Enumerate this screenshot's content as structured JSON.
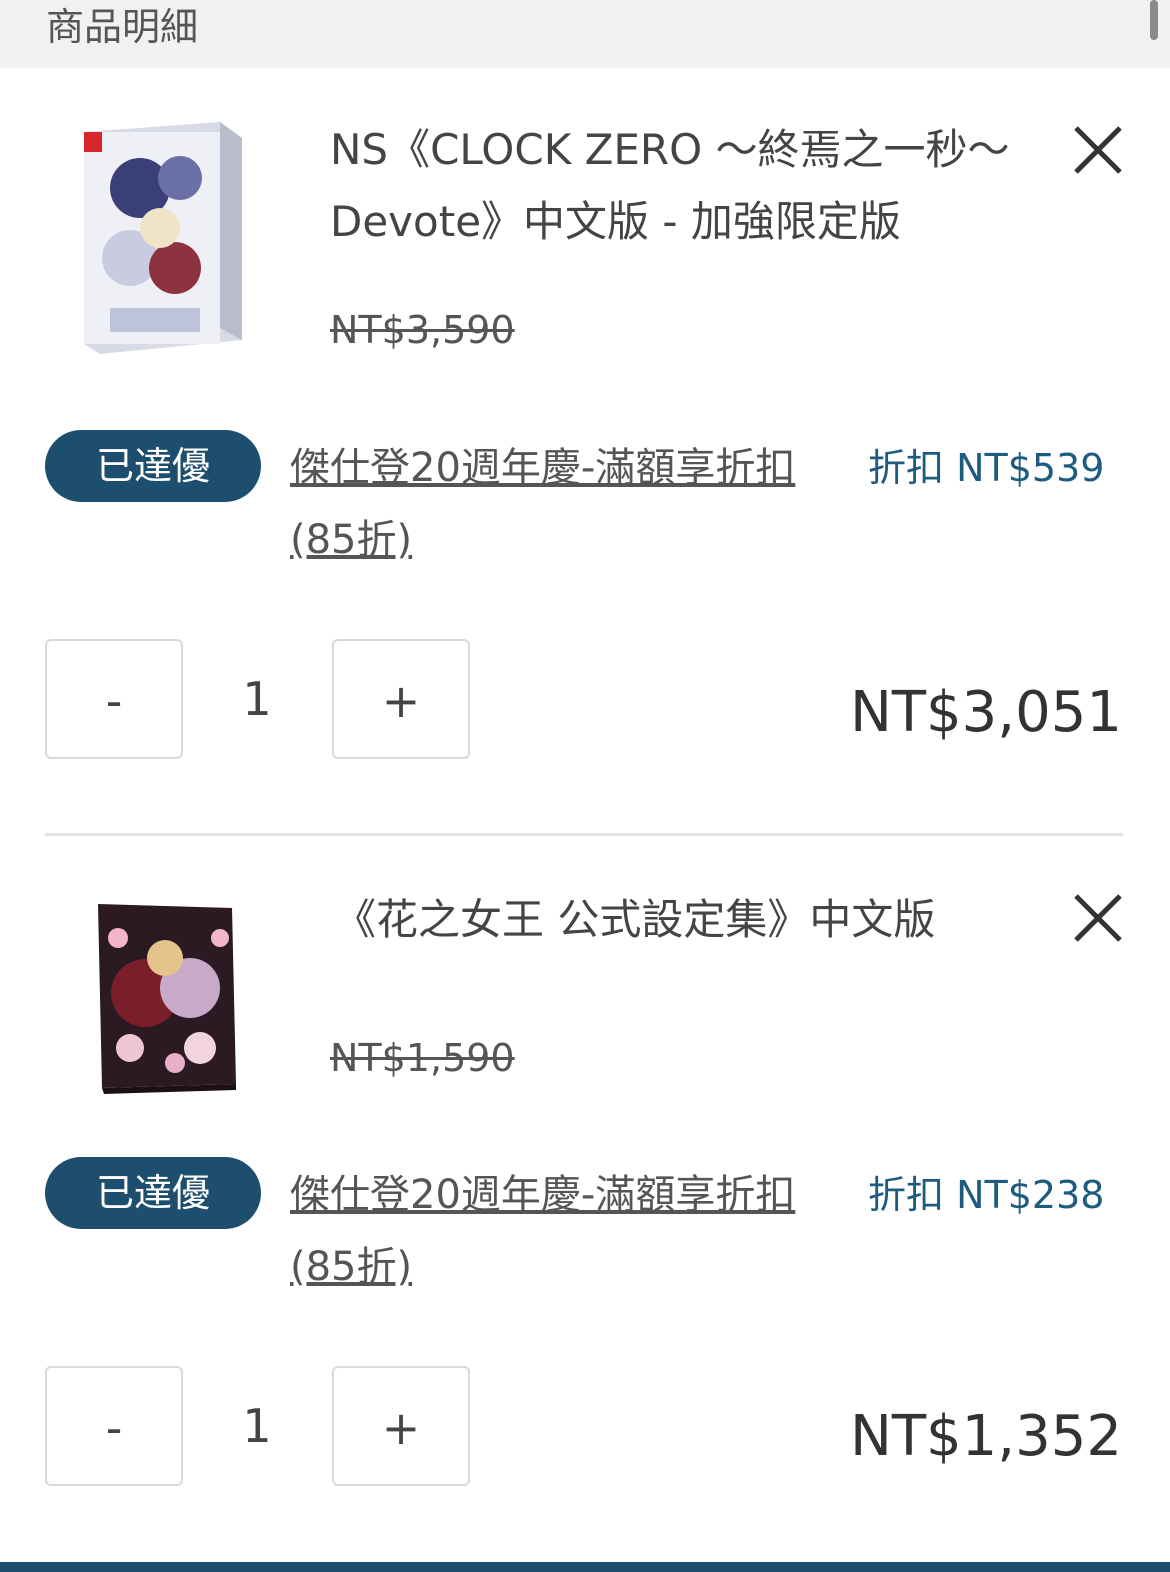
{
  "header": {
    "title": "商品明細"
  },
  "items": [
    {
      "name": "NS《CLOCK ZERO ～終焉之一秒～ Devote》中文版 - 加強限定版",
      "original_price": "NT$3,590",
      "promo_badge": "已達優",
      "promo_name": "傑仕登20週年慶-滿額享折扣(85折)",
      "discount": "折扣 NT$539",
      "qty_minus": "-",
      "quantity": "1",
      "qty_plus": "+",
      "line_total": "NT$3,051"
    },
    {
      "name": "《花之女王 公式設定集》中文版",
      "original_price": "NT$1,590",
      "promo_badge": "已達優",
      "promo_name": "傑仕登20週年慶-滿額享折扣(85折)",
      "discount": "折扣 NT$238",
      "qty_minus": "-",
      "quantity": "1",
      "qty_plus": "+",
      "line_total": "NT$1,352"
    }
  ],
  "colors": {
    "accent": "#1d4e6e",
    "discount_text": "#1d5b80",
    "header_bg": "#f0f1f3"
  },
  "icons": {
    "remove": "close-icon"
  }
}
